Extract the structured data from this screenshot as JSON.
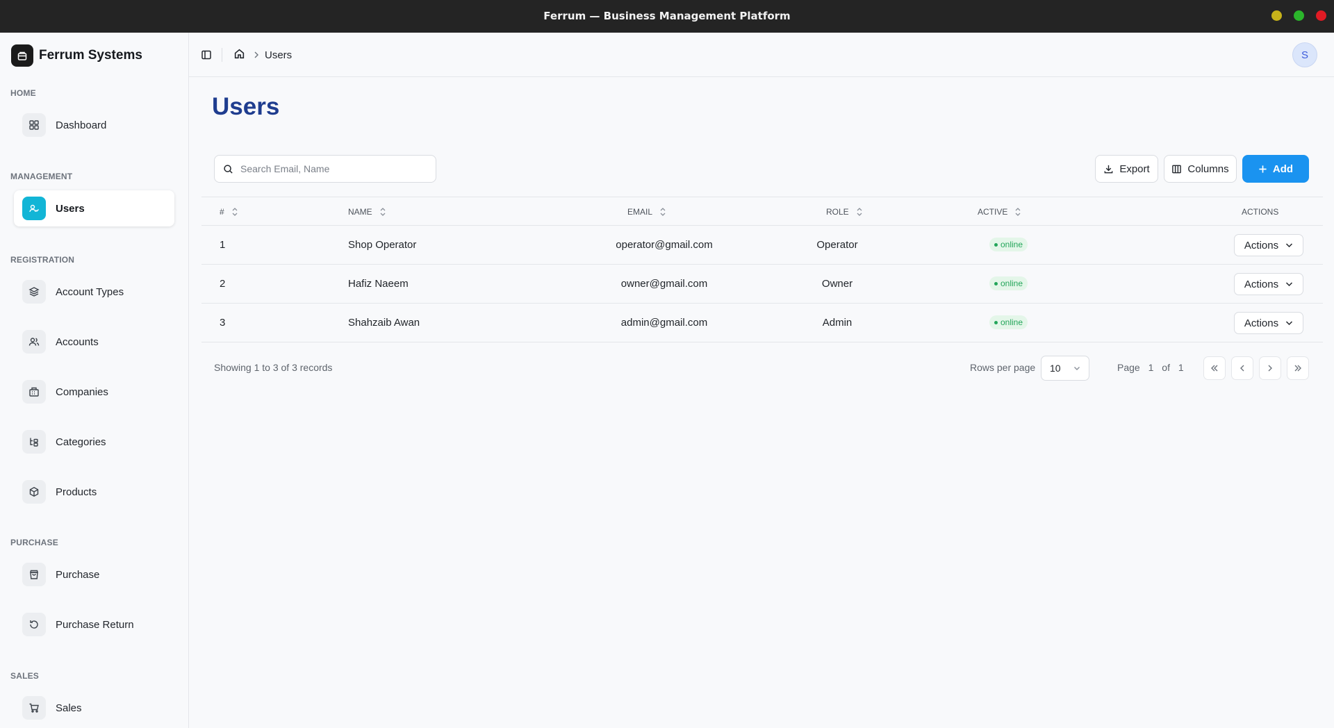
{
  "window": {
    "title": "Ferrum — Business Management Platform",
    "buttons": {
      "minimize_color": "#c7b21a",
      "maximize_color": "#2bb52b",
      "close_color": "#e01b24"
    }
  },
  "brand": {
    "name": "Ferrum Systems"
  },
  "sidebar": {
    "sections": [
      {
        "label": "HOME"
      },
      {
        "label": "MANAGEMENT"
      },
      {
        "label": "REGISTRATION"
      },
      {
        "label": "PURCHASE"
      },
      {
        "label": "SALES"
      }
    ],
    "items": [
      {
        "label": "Dashboard",
        "icon": "dashboard-icon"
      },
      {
        "label": "Users",
        "icon": "users-icon",
        "active": true
      },
      {
        "label": "Account Types",
        "icon": "layers-icon"
      },
      {
        "label": "Accounts",
        "icon": "accounts-icon"
      },
      {
        "label": "Companies",
        "icon": "building-icon"
      },
      {
        "label": "Categories",
        "icon": "categories-icon"
      },
      {
        "label": "Products",
        "icon": "box-icon"
      },
      {
        "label": "Purchase",
        "icon": "bag-icon"
      },
      {
        "label": "Purchase Return",
        "icon": "return-icon"
      },
      {
        "label": "Sales",
        "icon": "cart-icon"
      }
    ]
  },
  "header": {
    "breadcrumb_current": "Users",
    "avatar_initial": "S"
  },
  "main": {
    "title": "Users",
    "search_placeholder": "Search Email, Name",
    "export_label": "Export",
    "columns_label": "Columns",
    "add_label": "Add",
    "accent_color": "#1a93f0"
  },
  "table": {
    "columns": [
      "#",
      "NAME",
      "EMAIL",
      "ROLE",
      "ACTIVE",
      "ACTIONS"
    ],
    "rows": [
      {
        "index": "1",
        "name": "Shop Operator",
        "email": "operator@gmail.com",
        "role": "Operator",
        "status": "online",
        "action": "Actions"
      },
      {
        "index": "2",
        "name": "Hafiz Naeem",
        "email": "owner@gmail.com",
        "role": "Owner",
        "status": "online",
        "action": "Actions"
      },
      {
        "index": "3",
        "name": "Shahzaib Awan",
        "email": "admin@gmail.com",
        "role": "Admin",
        "status": "online",
        "action": "Actions"
      }
    ]
  },
  "footer": {
    "records_text": "Showing 1 to 3 of 3 records",
    "rows_per_page_label": "Rows per page",
    "rows_per_page_value": "10",
    "page_label": "Page",
    "page_current": "1",
    "page_of": "of",
    "page_total": "1"
  }
}
